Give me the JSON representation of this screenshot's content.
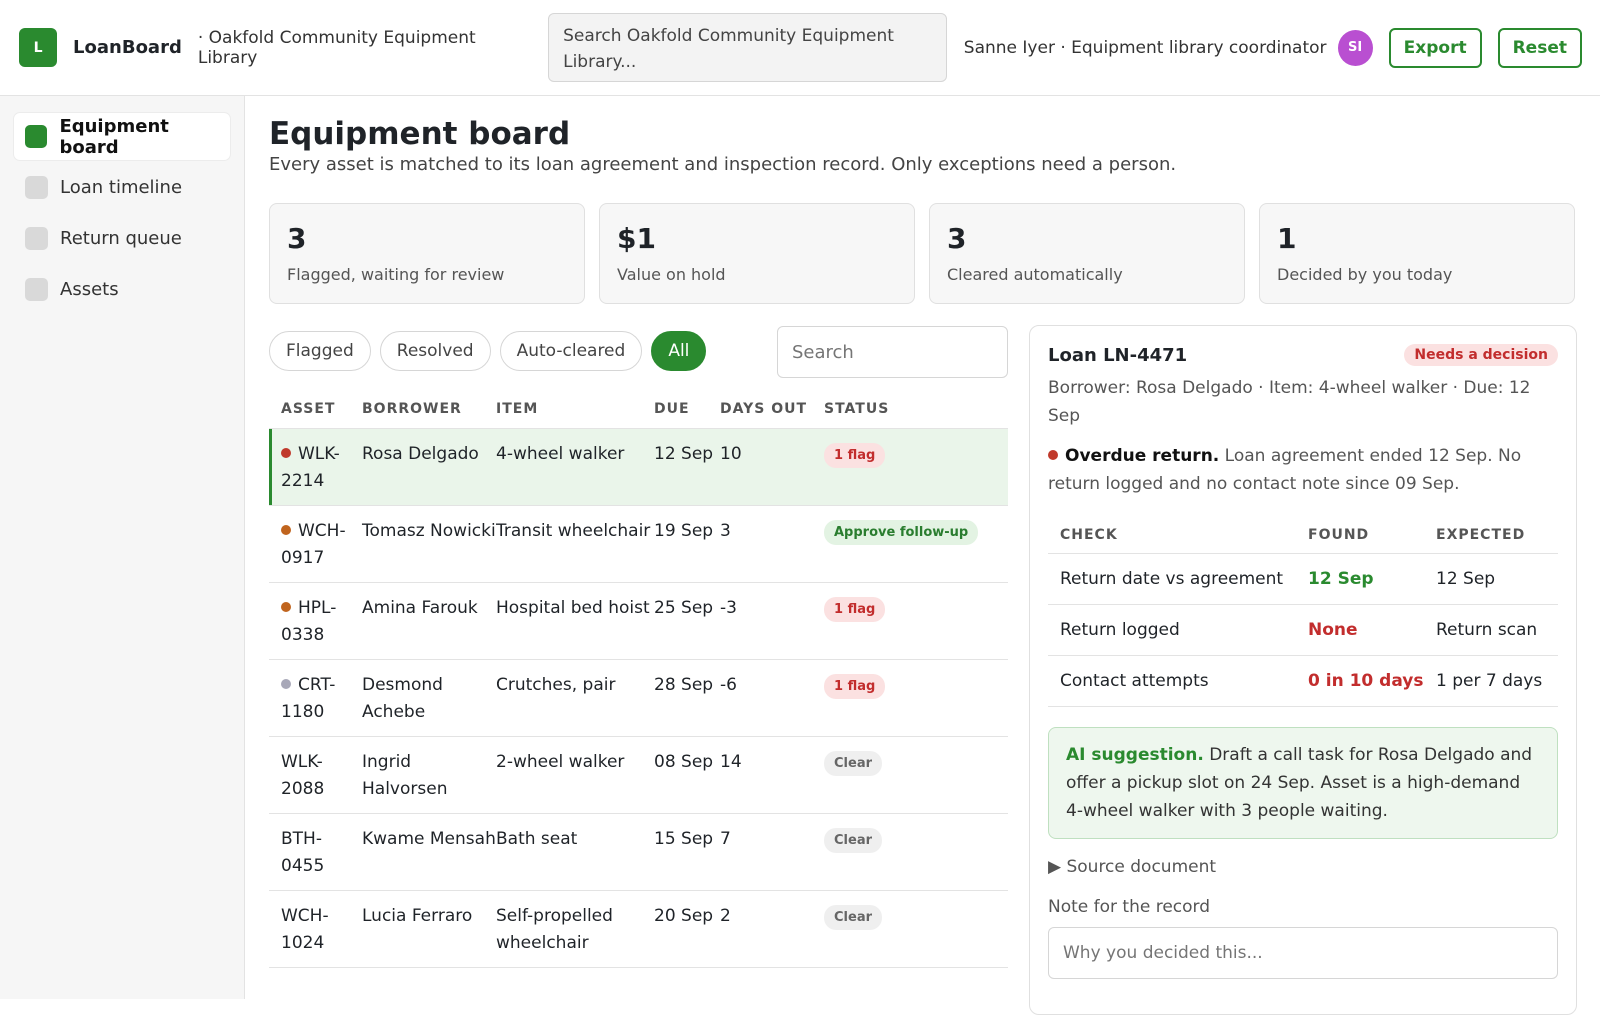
{
  "header": {
    "logo_letter": "L",
    "app_name": "LoanBoard",
    "org_name": "· Oakfold Community Equipment Library",
    "search_placeholder": "Search Oakfold Community Equipment Library...",
    "user": "Sanne Iyer · Equipment library coordinator",
    "avatar_initials": "SI",
    "export_label": "Export",
    "reset_label": "Reset"
  },
  "sidebar": {
    "items": [
      {
        "label": "Equipment board",
        "active": true
      },
      {
        "label": "Loan timeline",
        "active": false
      },
      {
        "label": "Return queue",
        "active": false
      },
      {
        "label": "Assets",
        "active": false
      }
    ]
  },
  "page": {
    "title": "Equipment board",
    "subtitle": "Every asset is matched to its loan agreement and inspection record. Only exceptions need a person."
  },
  "stats": [
    {
      "value": "3",
      "label": "Flagged, waiting for review"
    },
    {
      "value": "$1",
      "label": "Value on hold"
    },
    {
      "value": "3",
      "label": "Cleared automatically"
    },
    {
      "value": "1",
      "label": "Decided by you today"
    }
  ],
  "filters": {
    "pills": [
      "Flagged",
      "Resolved",
      "Auto-cleared",
      "All"
    ],
    "active": "All",
    "search_placeholder": "Search"
  },
  "table": {
    "columns": [
      "ASSET",
      "BORROWER",
      "ITEM",
      "DUE",
      "DAYS OUT",
      "STATUS"
    ],
    "rows": [
      {
        "asset": "WLK-2214",
        "borrower": "Rosa Delgado",
        "item": "4-wheel walker",
        "due": "12 Sep",
        "days": "10",
        "status": "1 flag",
        "status_kind": "red",
        "dot": "#c0392b",
        "selected": true
      },
      {
        "asset": "WCH-0917",
        "borrower": "Tomasz Nowicki",
        "item": "Transit wheelchair",
        "due": "19 Sep",
        "days": "3",
        "status": "Approve follow-up",
        "status_kind": "green",
        "dot": "#c0641e",
        "selected": false
      },
      {
        "asset": "HPL-0338",
        "borrower": "Amina Farouk",
        "item": "Hospital bed hoist",
        "due": "25 Sep",
        "days": "-3",
        "status": "1 flag",
        "status_kind": "red",
        "dot": "#c0641e",
        "selected": false
      },
      {
        "asset": "CRT-1180",
        "borrower": "Desmond Achebe",
        "item": "Crutches, pair",
        "due": "28 Sep",
        "days": "-6",
        "status": "1 flag",
        "status_kind": "red",
        "dot": "#a8a8b8",
        "selected": false
      },
      {
        "asset": "WLK-2088",
        "borrower": "Ingrid Halvorsen",
        "item": "2-wheel walker",
        "due": "08 Sep",
        "days": "14",
        "status": "Clear",
        "status_kind": "gray",
        "dot": "",
        "selected": false
      },
      {
        "asset": "BTH-0455",
        "borrower": "Kwame Mensah",
        "item": "Bath seat",
        "due": "15 Sep",
        "days": "7",
        "status": "Clear",
        "status_kind": "gray",
        "dot": "",
        "selected": false
      },
      {
        "asset": "WCH-1024",
        "borrower": "Lucia Ferraro",
        "item": "Self-propelled wheelchair",
        "due": "20 Sep",
        "days": "2",
        "status": "Clear",
        "status_kind": "gray",
        "dot": "",
        "selected": false
      }
    ]
  },
  "detail": {
    "title": "Loan LN-4471",
    "badge": "Needs a decision",
    "meta": "Borrower: Rosa Delgado · Item: 4-wheel walker · Due: 12 Sep",
    "alert_title": "Overdue return.",
    "alert_text": "Loan agreement ended 12 Sep. No return logged and no contact note since 09 Sep.",
    "check_columns": [
      "CHECK",
      "FOUND",
      "EXPECTED"
    ],
    "checks": [
      {
        "check": "Return date vs agreement",
        "found": "12 Sep",
        "expected": "12 Sep",
        "ok": true
      },
      {
        "check": "Return logged",
        "found": "None",
        "expected": "Return scan",
        "ok": false
      },
      {
        "check": "Contact attempts",
        "found": "0 in 10 days",
        "expected": "1 per 7 days",
        "ok": false
      }
    ],
    "ai_label": "AI suggestion.",
    "ai_text": "Draft a call task for Rosa Delgado and offer a pickup slot on 24 Sep. Asset is a high-demand 4-wheel walker with 3 people waiting.",
    "source_label": "▶ Source document",
    "note_label": "Note for the record",
    "note_placeholder": "Why you decided this..."
  },
  "colors": {
    "accent": "#2a8a2f",
    "danger": "#c22d2d",
    "avatar": "#b94fd1"
  }
}
